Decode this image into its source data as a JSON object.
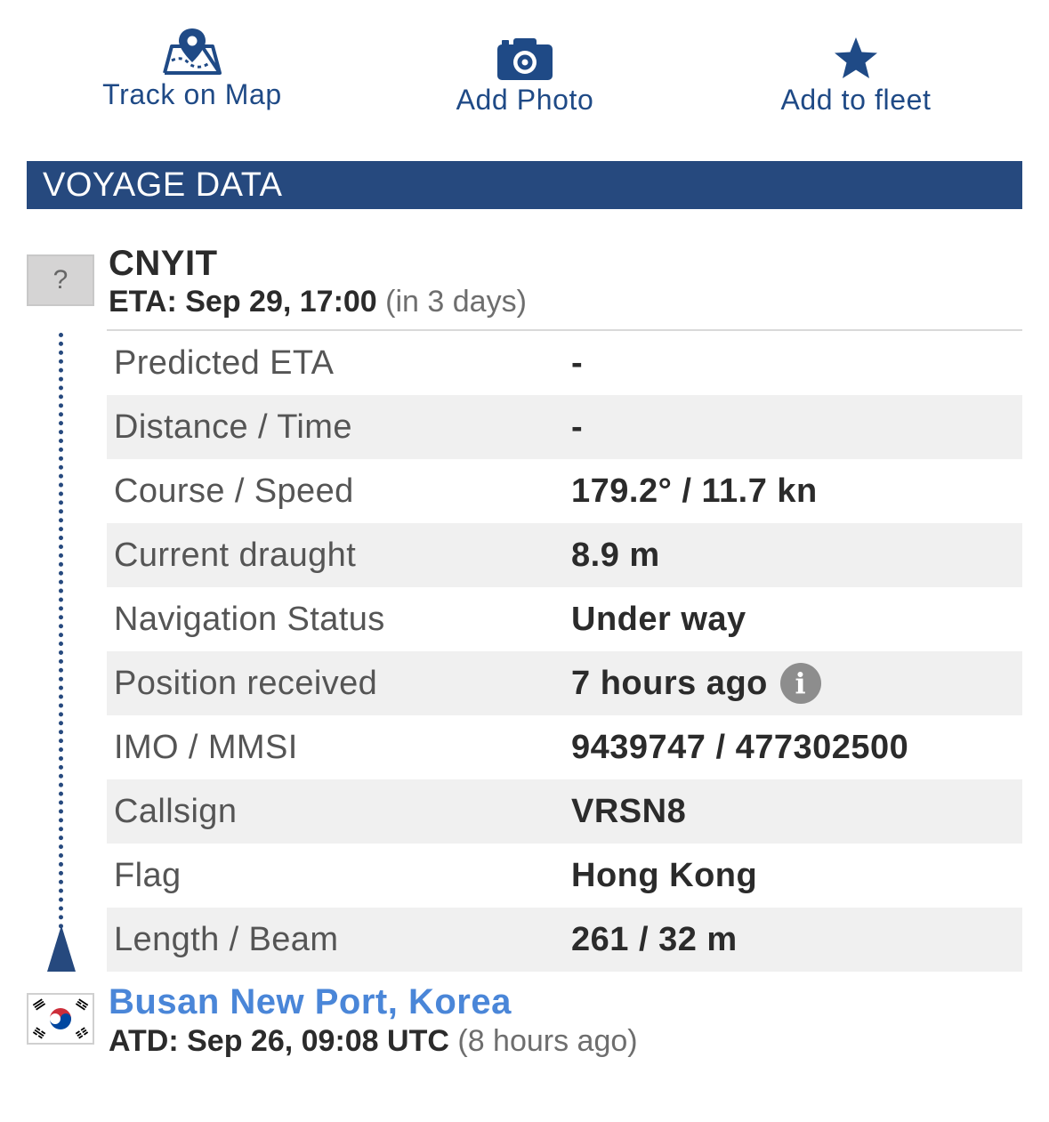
{
  "actions": {
    "track": {
      "label": "Track on Map",
      "icon": "map-pin-icon"
    },
    "photo": {
      "label": "Add Photo",
      "icon": "camera-icon"
    },
    "fleet": {
      "label": "Add to fleet",
      "icon": "star-icon"
    }
  },
  "section": {
    "title": "VOYAGE DATA"
  },
  "destination": {
    "flag_placeholder": "?",
    "name": "CNYIT",
    "eta_label": "ETA: Sep 29, 17:00",
    "eta_relative": "(in 3 days)"
  },
  "rows": [
    {
      "key": "Predicted ETA",
      "value": "-"
    },
    {
      "key": "Distance / Time",
      "value": "-"
    },
    {
      "key": "Course / Speed",
      "value": "179.2° / 11.7 kn"
    },
    {
      "key": "Current draught",
      "value": "8.9 m"
    },
    {
      "key": "Navigation Status",
      "value": "Under way"
    },
    {
      "key": "Position received",
      "value": "7 hours ago",
      "info_icon": "i"
    },
    {
      "key": "IMO / MMSI",
      "value": "9439747 / 477302500"
    },
    {
      "key": "Callsign",
      "value": "VRSN8"
    },
    {
      "key": "Flag",
      "value": "Hong Kong"
    },
    {
      "key": "Length / Beam",
      "value": "261 / 32 m"
    }
  ],
  "origin": {
    "flag_icon": "south-korea-flag-icon",
    "name": "Busan New Port, Korea",
    "atd_label": "ATD: Sep 26, 09:08 UTC",
    "atd_relative": "(8 hours ago)"
  },
  "colors": {
    "accent": "#26497e",
    "link": "#4a86d8",
    "row_alt": "#f0f0f0"
  }
}
